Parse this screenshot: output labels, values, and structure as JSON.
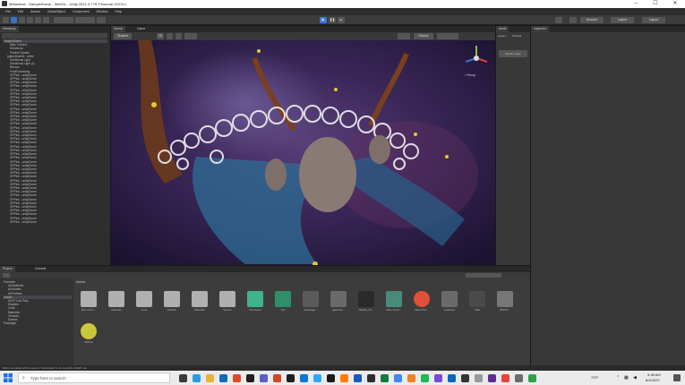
{
  "window": {
    "title": "Metaverse - SampleScene - WebGL - Unity 2021.3.??f1 Personal <DX11>",
    "minimize": "–",
    "maximize": "☐",
    "close": "✕"
  },
  "menu": [
    "File",
    "Edit",
    "Assets",
    "GameObject",
    "Component",
    "Window",
    "Help"
  ],
  "toolbar": {
    "account": "Account",
    "layers": "Layers",
    "layout": "Layout"
  },
  "hierarchy": {
    "tab": "Hierarchy",
    "items": [
      "SampleScene",
      "Main Camera",
      "Directiona",
      "Particle System",
      "(plane)bubble - white",
      "Directional Light",
      "Directional Light (1)",
      "Neuron",
      "PostProcessing",
      "GPPink - unity/Dome",
      "GPPink - unity/Dome",
      "GPPink - unity/Dome",
      "GPPink - unity/Dome",
      "GPPink - unity/Dome",
      "GPPink - unity/Dome",
      "GPPink - unity/Dome",
      "GPPink - unity/Dome",
      "GPPink - unity/Dome",
      "GPPink - unity/Dome",
      "GPPink - unity/Dome",
      "GPPink - unity/Dome",
      "GPPink - unity/Dome",
      "GPPink - unity/Dome",
      "GPPink - unity/Dome",
      "GPPink - unity/Dome",
      "GPPink - unity/Dome",
      "GPPink - unity/Dome",
      "GPPink - unity/Dome",
      "GPPink - unity/Dome",
      "GPPink - unity/Dome",
      "GPPink - unity/Dome",
      "GPPink - unity/Dome",
      "GPPink - unity/Dome",
      "GPPink - unity/Dome",
      "GPPink - unity/Dome",
      "GPPink - unity/Dome",
      "GPPink - unity/Dome",
      "GPPink - unity/Dome",
      "GPPink - unity/Dome",
      "GPPink - unity/Dome",
      "GPPink - unity/Dome",
      "GPPink - unity/Dome",
      "GPPink - unity/Dome",
      "GPPink - unity/Dome",
      "GPPink - unity/Dome",
      "GPPink - unity/Dome",
      "GPPink - unity/Dome",
      "GPPink - unity/Dome",
      "GPPink - unity/Dome"
    ]
  },
  "scene_tabs": {
    "scene": "Scene",
    "game": "Game",
    "shaded": "Shaded",
    "view2d": "2D",
    "gizmos": "Gizmos"
  },
  "gizmo": {
    "label": "< Persp"
  },
  "side_panel": {
    "tab": "Asset",
    "subtab1": "Layers",
    "subtab2": "Presets",
    "button": "Revert Layer"
  },
  "inspector": {
    "tab": "Inspector"
  },
  "project": {
    "tab_project": "Project",
    "tab_console": "Console",
    "breadcrumb": "Assets",
    "tree": [
      "Favorites",
      "All Materials",
      "All Models",
      "All Prefabs",
      "Assets",
      "Sci-Fi Low Poly...",
      "Shaders",
      "Code",
      "Materials",
      "Textures",
      "Scenes",
      "Packages"
    ],
    "assets": [
      "Sci Low Po...",
      "Materials",
      "Code",
      "Prefabs",
      "Materials",
      "Scenes",
      "Sub Game",
      "Text",
      "Rectangle...",
      "glassmat...",
      "Bubble_sh...",
      "Main Came...",
      "Wave Prof...",
      "noiselines",
      "Wall",
      "GPPink...",
      "GPPink"
    ]
  },
  "status": {
    "message": "Build completed with a result of 'Succeeded' in 41 seconds (41018 ms)"
  },
  "taskbar": {
    "search_placeholder": "Type here to search",
    "time": "9:38 AM",
    "date": "8/4/2022",
    "weather": "73°F"
  },
  "colors": {
    "accent": "#3a72c4",
    "play_active": "#3d7be0",
    "scene_bg": "#2b1a3e"
  }
}
